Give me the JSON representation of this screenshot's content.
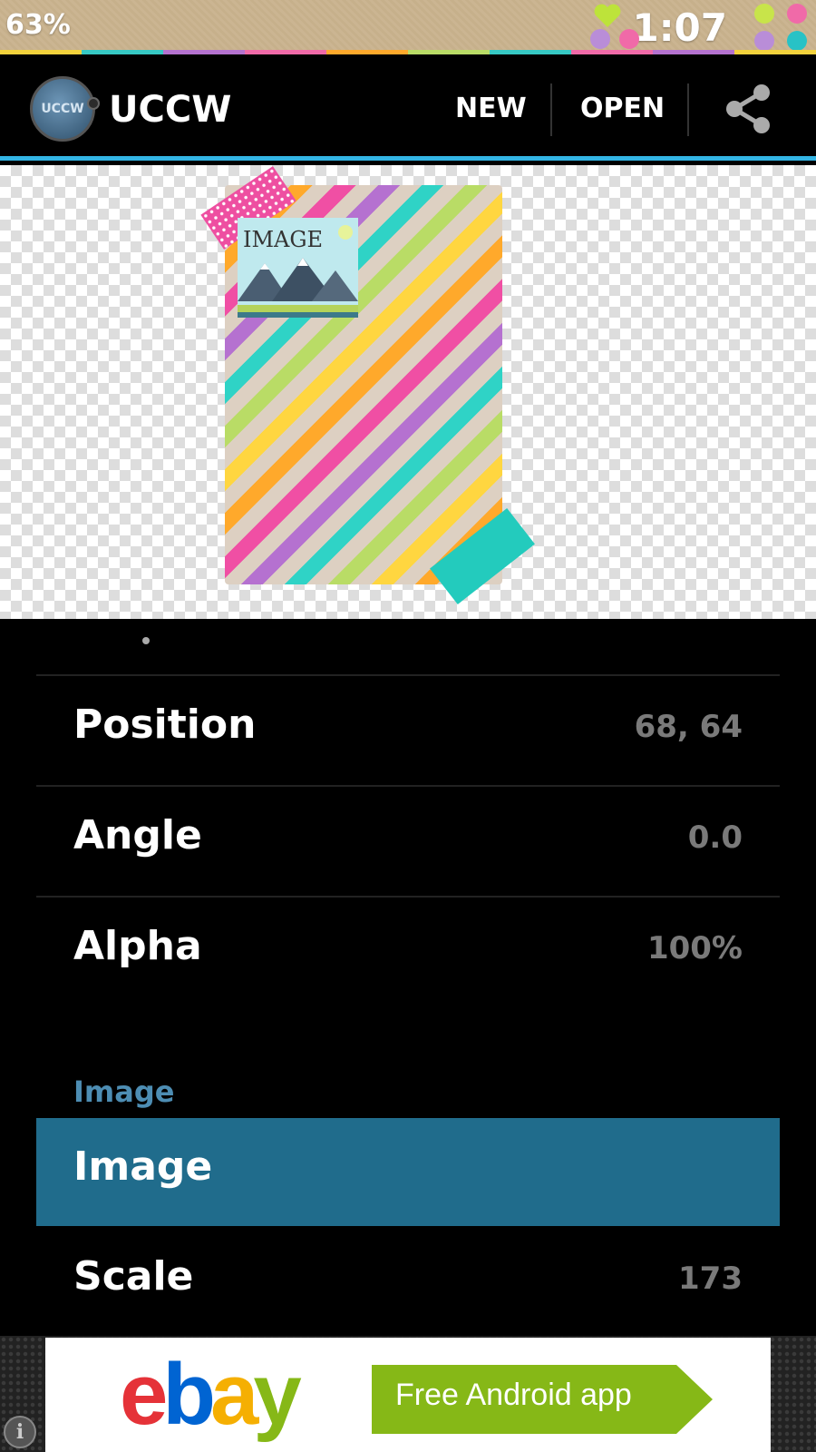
{
  "status_bar": {
    "battery": "63%",
    "time": "1:07"
  },
  "action_bar": {
    "app_logo_text": "UCCW",
    "app_title": "UCCW",
    "new_label": "NEW",
    "open_label": "OPEN"
  },
  "preview": {
    "image_label": "IMAGE"
  },
  "properties": [
    {
      "label": "Position",
      "value": "68, 64"
    },
    {
      "label": "Angle",
      "value": "0.0"
    },
    {
      "label": "Alpha",
      "value": "100%"
    }
  ],
  "image_section": {
    "header": "Image",
    "selected_label": "Image",
    "scale_label": "Scale",
    "scale_value": "173"
  },
  "ad": {
    "brand": {
      "e": "e",
      "b": "b",
      "a": "a",
      "y": "y"
    },
    "cta": "Free Android app"
  },
  "colors": {
    "accent": "#33b5e5",
    "selected_row": "#206c8c",
    "section_header": "#4d8db3"
  }
}
